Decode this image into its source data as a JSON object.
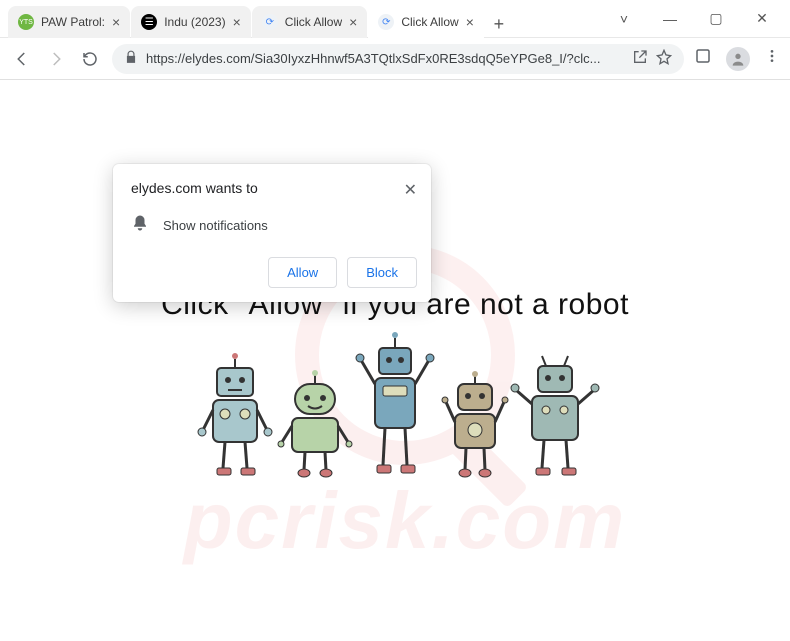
{
  "tabs": [
    {
      "title": "PAW Patrol:",
      "icon_bg": "#6fb742",
      "icon_color": "#fff",
      "icon_text": "YTS"
    },
    {
      "title": "Indu (2023)",
      "icon_bg": "#000",
      "icon_color": "#fff",
      "icon_text": "☰"
    },
    {
      "title": "Click Allow",
      "icon_bg": "#eef2f6",
      "icon_color": "#4285f4",
      "icon_text": "⟳"
    },
    {
      "title": "Click Allow",
      "icon_bg": "#eef2f6",
      "icon_color": "#4285f4",
      "icon_text": "⟳"
    }
  ],
  "address": {
    "url": "https://elydes.com/Sia30IyxzHhnwf5A3TQtlxSdFx0RE3sdqQ5eYPGe8_I/?clc..."
  },
  "permission": {
    "title": "elydes.com wants to",
    "line": "Show notifications",
    "allow": "Allow",
    "block": "Block"
  },
  "page": {
    "headline": "Click \"Allow\"   if you are not   a robot"
  },
  "watermark": {
    "brand_prefix": "pc",
    "brand_suffix": "risk.com"
  }
}
